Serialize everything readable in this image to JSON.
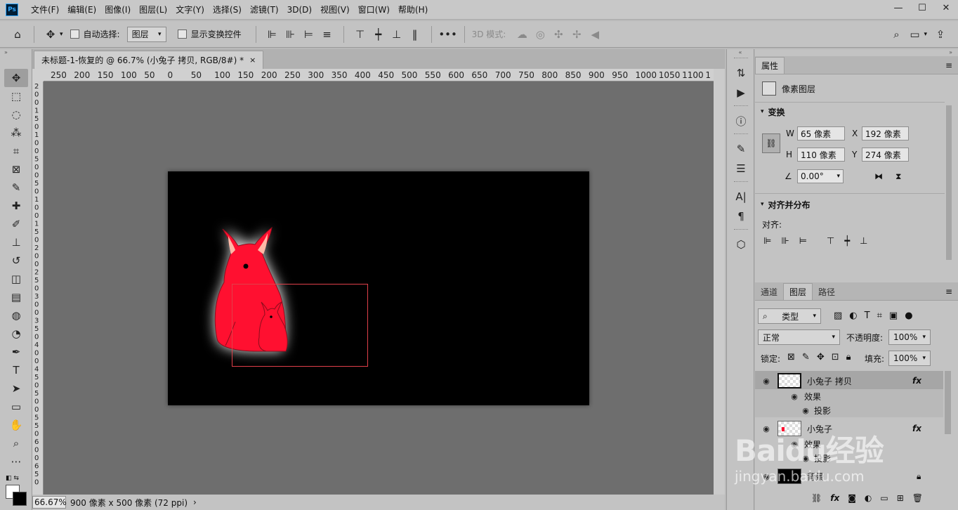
{
  "app": {
    "logo": "Ps"
  },
  "menu": [
    "文件(F)",
    "编辑(E)",
    "图像(I)",
    "图层(L)",
    "文字(Y)",
    "选择(S)",
    "滤镜(T)",
    "3D(D)",
    "视图(V)",
    "窗口(W)",
    "帮助(H)"
  ],
  "window_controls": {
    "minimize": "—",
    "maximize": "☐",
    "close": "✕"
  },
  "options": {
    "auto_select_label": "自动选择:",
    "auto_select_target": "图层",
    "show_transform_label": "显示变换控件",
    "more": "•••",
    "mode_3d": "3D 模式:"
  },
  "document": {
    "tab_title": "未标题-1-恢复的 @ 66.7% (小兔子 拷贝, RGB/8#) *",
    "close": "×",
    "ruler_h": [
      "250",
      "200",
      "150",
      "100",
      "50",
      "0",
      "50",
      "100",
      "150",
      "200",
      "250",
      "300",
      "350",
      "400",
      "450",
      "500",
      "550",
      "600",
      "650",
      "700",
      "750",
      "800",
      "850",
      "900",
      "950",
      "1000",
      "1050",
      "1100",
      "1"
    ],
    "ruler_v": [
      "2",
      "0",
      "0",
      "1",
      "5",
      "0",
      "1",
      "0",
      "0",
      "5",
      "0",
      "0",
      "5",
      "0",
      "1",
      "0",
      "0",
      "1",
      "5",
      "0",
      "2",
      "0",
      "0",
      "2",
      "5",
      "0",
      "3",
      "0",
      "0",
      "3",
      "5",
      "0",
      "4",
      "0",
      "0",
      "4",
      "5",
      "0",
      "5",
      "0",
      "0",
      "5",
      "5",
      "0",
      "6",
      "0",
      "0",
      "6",
      "5",
      "0"
    ]
  },
  "status": {
    "zoom": "66.67%",
    "info": "900 像素 x 500 像素 (72 ppi)",
    "arrow": "›"
  },
  "properties": {
    "tab": "属性",
    "kind": "像素图层",
    "transform_title": "变换",
    "w_label": "W",
    "w_value": "65 像素",
    "h_label": "H",
    "h_value": "110 像素",
    "x_label": "X",
    "x_value": "192 像素",
    "y_label": "Y",
    "y_value": "274 像素",
    "angle_value": "0.00°",
    "align_title": "对齐并分布",
    "align_label": "对齐:"
  },
  "layers_panel": {
    "tabs": [
      "通道",
      "图层",
      "路径"
    ],
    "active_tab": 1,
    "filter_label": "类型",
    "blend_mode": "正常",
    "opacity_label": "不透明度:",
    "opacity_value": "100%",
    "lock_label": "锁定:",
    "fill_label": "填充:",
    "fill_value": "100%",
    "layers": [
      {
        "name": "小兔子 拷贝",
        "fx": "fx",
        "effects_label": "效果",
        "effect": "投影"
      },
      {
        "name": "小兔子",
        "fx": "fx",
        "effects_label": "效果",
        "effect": "投影"
      },
      {
        "name": "背景"
      }
    ],
    "bottom_icons": [
      "link-icon",
      "fx-icon",
      "mask-icon",
      "adjustment-icon",
      "folder-icon",
      "new-layer-icon",
      "trash-icon"
    ],
    "fx_text": "fx"
  },
  "watermark": {
    "brand": "Baidu经验",
    "url": "jingyan.baidu.com"
  },
  "colors": {
    "accent_red": "#ff1030",
    "canvas_bg": "#6e6e6e",
    "selection": "#e0404a"
  }
}
